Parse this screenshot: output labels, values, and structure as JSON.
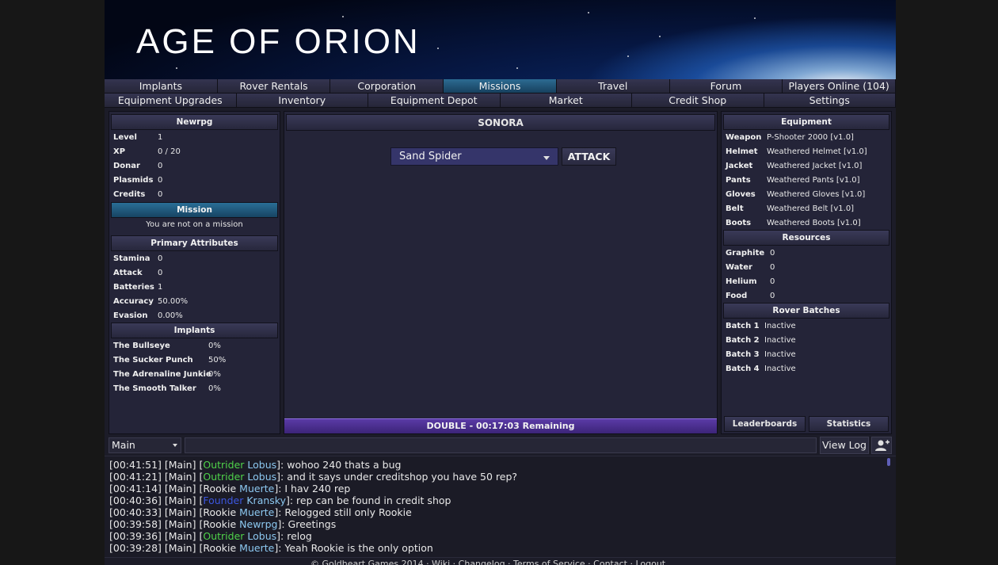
{
  "banner": {
    "title": "AGE OF ORION"
  },
  "nav_row1": [
    "Implants",
    "Rover Rentals",
    "Corporation",
    "Missions",
    "Travel",
    "Forum",
    "Players Online (104)"
  ],
  "nav_row2": [
    "Equipment Upgrades",
    "Inventory",
    "Equipment Depot",
    "Market",
    "Credit Shop",
    "Settings"
  ],
  "active_nav": "Missions",
  "player": {
    "name": "Newrpg",
    "stats": [
      {
        "label": "Level",
        "value": "1"
      },
      {
        "label": "XP",
        "value": "0 / 20"
      },
      {
        "label": "Donar",
        "value": "0"
      },
      {
        "label": "Plasmids",
        "value": "0"
      },
      {
        "label": "Credits",
        "value": "0"
      }
    ]
  },
  "mission": {
    "header": "Mission",
    "message": "You are not on a mission"
  },
  "primary_attributes": {
    "header": "Primary Attributes",
    "items": [
      {
        "label": "Stamina",
        "value": "0"
      },
      {
        "label": "Attack",
        "value": "0"
      },
      {
        "label": "Batteries",
        "value": "1"
      },
      {
        "label": "Accuracy",
        "value": "50.00%"
      },
      {
        "label": "Evasion",
        "value": "0.00%"
      }
    ]
  },
  "implants": {
    "header": "Implants",
    "items": [
      {
        "label": "The Bullseye",
        "value": "0%"
      },
      {
        "label": "The Sucker Punch",
        "value": "50%"
      },
      {
        "label": "The Adrenaline Junkie",
        "value": "0%"
      },
      {
        "label": "The Smooth Talker",
        "value": "0%"
      }
    ]
  },
  "zone": {
    "name": "SONORA",
    "selected_monster": "Sand Spider",
    "attack_label": "ATTACK",
    "double_status": "DOUBLE - 00:17:03 Remaining"
  },
  "equipment": {
    "header": "Equipment",
    "items": [
      {
        "label": "Weapon",
        "value": "P-Shooter 2000 [v1.0]"
      },
      {
        "label": "Helmet",
        "value": "Weathered Helmet [v1.0]"
      },
      {
        "label": "Jacket",
        "value": "Weathered Jacket [v1.0]"
      },
      {
        "label": "Pants",
        "value": "Weathered Pants [v1.0]"
      },
      {
        "label": "Gloves",
        "value": "Weathered Gloves [v1.0]"
      },
      {
        "label": "Belt",
        "value": "Weathered Belt [v1.0]"
      },
      {
        "label": "Boots",
        "value": "Weathered Boots [v1.0]"
      }
    ]
  },
  "resources": {
    "header": "Resources",
    "items": [
      {
        "label": "Graphite",
        "value": "0"
      },
      {
        "label": "Water",
        "value": "0"
      },
      {
        "label": "Helium",
        "value": "0"
      },
      {
        "label": "Food",
        "value": "0"
      }
    ]
  },
  "rover_batches": {
    "header": "Rover Batches",
    "items": [
      {
        "label": "Batch 1",
        "value": "Inactive"
      },
      {
        "label": "Batch 2",
        "value": "Inactive"
      },
      {
        "label": "Batch 3",
        "value": "Inactive"
      },
      {
        "label": "Batch 4",
        "value": "Inactive"
      }
    ]
  },
  "right_buttons": {
    "leaderboards": "Leaderboards",
    "statistics": "Statistics"
  },
  "chat": {
    "channel": "Main",
    "input_value": "",
    "view_log_label": "View Log",
    "icons": {
      "users": "user-add-icon"
    },
    "messages": [
      {
        "time": "[00:41:51]",
        "channel": "[Main]",
        "rank": "Outrider",
        "player": "Lobus",
        "text": ": wohoo 240 thats a bug"
      },
      {
        "time": "[00:41:21]",
        "channel": "[Main]",
        "rank": "Outrider",
        "player": "Lobus",
        "text": ": and it says under creditshop you have 50 rep?"
      },
      {
        "time": "[00:41:14]",
        "channel": "[Main]",
        "rank": "Rookie",
        "player": "Muerte",
        "text": ": I hav 240 rep"
      },
      {
        "time": "[00:40:36]",
        "channel": "[Main]",
        "rank": "Founder",
        "player": "Kransky",
        "text": ": rep can be found in credit shop"
      },
      {
        "time": "[00:40:33]",
        "channel": "[Main]",
        "rank": "Rookie",
        "player": "Muerte",
        "text": ": Relogged still only Rookie"
      },
      {
        "time": "[00:39:58]",
        "channel": "[Main]",
        "rank": "Rookie",
        "player": "Newrpg",
        "text": ": Greetings"
      },
      {
        "time": "[00:39:36]",
        "channel": "[Main]",
        "rank": "Outrider",
        "player": "Lobus",
        "text": ": relog"
      },
      {
        "time": "[00:39:28]",
        "channel": "[Main]",
        "rank": "Rookie",
        "player": "Muerte",
        "text": ": Yeah Rookie is the only option"
      }
    ]
  },
  "colors": {
    "outrider": "#4fd24a",
    "founder": "#3c57e0",
    "player_name": "#8cc8f0",
    "double_bar": "#4a2e90"
  },
  "footer": {
    "text": "© Goldheart Games 2014 · Wiki · Changelog · Terms of Service · Contact · Logout"
  }
}
